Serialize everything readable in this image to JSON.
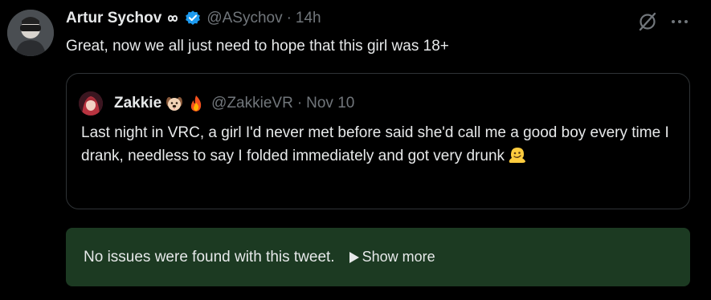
{
  "tweet": {
    "author": {
      "display_name": "Artur Sychov",
      "handle": "@ASychov",
      "avatar_icon": "user-avatar-photo",
      "verified_icon": "verified-badge-icon",
      "verified_color": "#1d9bf0"
    },
    "separator": "·",
    "timestamp": "14h",
    "text": "Great, now we all just need to hope that this girl was 18+",
    "actions": {
      "grok_icon": "slash-circle-icon",
      "more_icon": "more-dots-icon"
    }
  },
  "quote": {
    "author": {
      "display_name": "Zakkie",
      "handle": "@ZakkieVR",
      "avatar_icon": "anime-avatar",
      "name_emojis": [
        "dog-face-emoji",
        "fire-emoji"
      ]
    },
    "separator": "·",
    "timestamp": "Nov 10",
    "text": "Last night in VRC, a girl I'd never met before said she'd call me a good boy every time I drank, needless to say I folded immediately and got very drunk",
    "trailing_emoji": "melting-face-emoji"
  },
  "notice": {
    "message": "No issues were found with this tweet.",
    "show_more_label": "Show more",
    "background_color": "#1c3a22"
  }
}
